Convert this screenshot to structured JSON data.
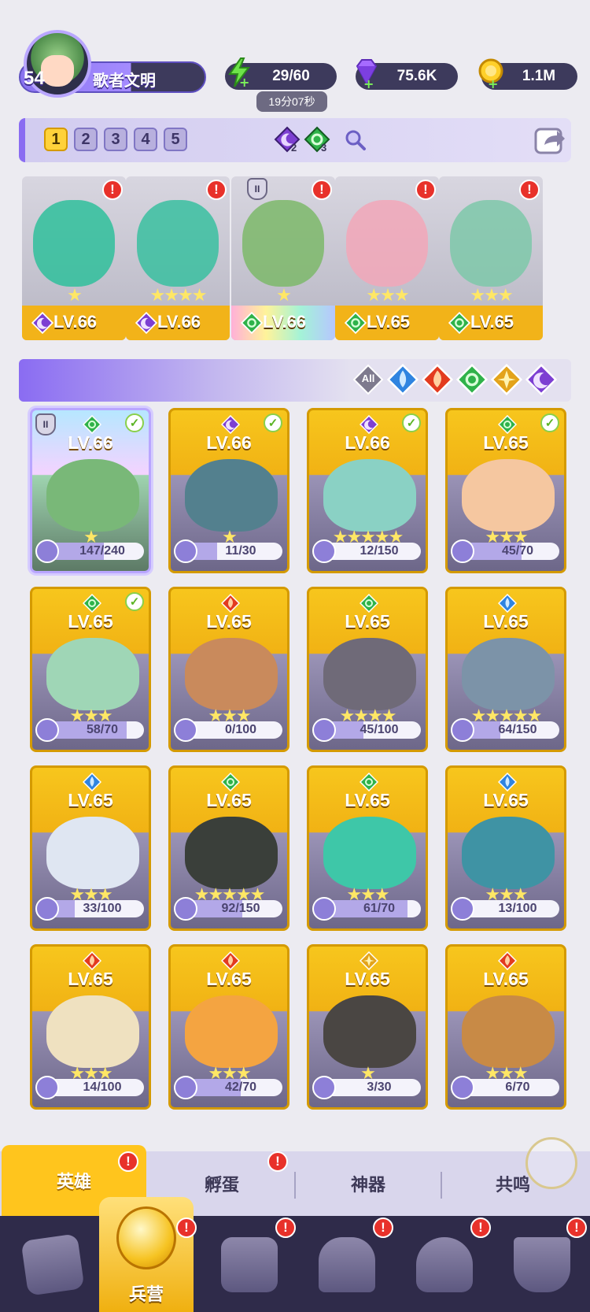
{
  "player": {
    "level": "54",
    "name": "歌者文明"
  },
  "resources": {
    "energy": "29/60",
    "energy_timer": "19分07秒",
    "gems": "75.6K",
    "coins": "1.1M"
  },
  "teams": {
    "tabs": [
      "1",
      "2",
      "3",
      "4",
      "5"
    ],
    "active": "1",
    "counters": [
      {
        "icon": "moon-element-icon",
        "count": "2"
      },
      {
        "icon": "leaf-element-icon",
        "count": "3"
      }
    ]
  },
  "team_slots": [
    {
      "level": "LV.66",
      "element": "moon",
      "stars": "★",
      "color": "#2fbf9b"
    },
    {
      "level": "LV.66",
      "element": "moon",
      "stars": "★★★★",
      "color": "#3ac0a0"
    },
    {
      "level": "LV.66",
      "element": "leaf",
      "stars": "★",
      "color": "#7cb86a",
      "rainbow": true
    },
    {
      "level": "LV.65",
      "element": "leaf",
      "stars": "★★★",
      "color": "#f2a7b8"
    },
    {
      "level": "LV.65",
      "element": "leaf",
      "stars": "★★★",
      "color": "#7ec8a9"
    }
  ],
  "filters": [
    "All",
    "water",
    "fire",
    "leaf",
    "light",
    "moon"
  ],
  "filter_all_label": "All",
  "colors": {
    "water": "#2f84e0",
    "fire": "#e33b1f",
    "leaf": "#2fb24a",
    "light": "#e3a31a",
    "moon": "#7d3fd2",
    "accent": "#8a6cf2"
  },
  "heroes": [
    {
      "level": "LV.66",
      "element": "leaf",
      "stars": "★",
      "progress": "147/240",
      "fraction": 0.61,
      "in_team": true,
      "selected": true,
      "art": "#79b878"
    },
    {
      "level": "LV.66",
      "element": "moon",
      "stars": "★",
      "progress": "11/30",
      "fraction": 0.37,
      "in_team": true,
      "art": "#53808e"
    },
    {
      "level": "LV.66",
      "element": "moon",
      "stars": "★★★★★",
      "progress": "12/150",
      "fraction": 0.08,
      "in_team": true,
      "art": "#8ad1c4"
    },
    {
      "level": "LV.65",
      "element": "leaf",
      "stars": "★★★",
      "progress": "45/70",
      "fraction": 0.64,
      "in_team": true,
      "art": "#f5c7a0"
    },
    {
      "level": "LV.65",
      "element": "leaf",
      "stars": "★★★",
      "progress": "58/70",
      "fraction": 0.83,
      "in_team": true,
      "art": "#9fd6b6"
    },
    {
      "level": "LV.65",
      "element": "fire",
      "stars": "★★★",
      "progress": "0/100",
      "fraction": 0,
      "art": "#c98a5c"
    },
    {
      "level": "LV.65",
      "element": "leaf",
      "stars": "★★★★",
      "progress": "45/100",
      "fraction": 0.45,
      "art": "#6f6a78"
    },
    {
      "level": "LV.65",
      "element": "water",
      "stars": "★★★★★",
      "progress": "64/150",
      "fraction": 0.43,
      "art": "#7c93a8"
    },
    {
      "level": "LV.65",
      "element": "water",
      "stars": "★★★",
      "progress": "33/100",
      "fraction": 0.33,
      "art": "#dfe6f2"
    },
    {
      "level": "LV.65",
      "element": "leaf",
      "stars": "★★★★★",
      "progress": "92/150",
      "fraction": 0.61,
      "art": "#3a3f3a"
    },
    {
      "level": "LV.65",
      "element": "leaf",
      "stars": "★★★",
      "progress": "61/70",
      "fraction": 0.87,
      "art": "#3ec7a8"
    },
    {
      "level": "LV.65",
      "element": "water",
      "stars": "★★★",
      "progress": "13/100",
      "fraction": 0.13,
      "art": "#3f93a4"
    },
    {
      "level": "LV.65",
      "element": "fire",
      "stars": "★★★",
      "progress": "14/100",
      "fraction": 0.14,
      "art": "#efe1c0"
    },
    {
      "level": "LV.65",
      "element": "fire",
      "stars": "★★★",
      "progress": "42/70",
      "fraction": 0.6,
      "art": "#f4a441"
    },
    {
      "level": "LV.65",
      "element": "light",
      "stars": "★",
      "progress": "3/30",
      "fraction": 0.1,
      "art": "#4a4643"
    },
    {
      "level": "LV.65",
      "element": "fire",
      "stars": "★★★",
      "progress": "6/70",
      "fraction": 0.09,
      "art": "#c88a46"
    }
  ],
  "subtabs": [
    "英雄",
    "孵蛋",
    "神器",
    "共鸣"
  ],
  "bottom_nav": {
    "active_label": "兵营",
    "items": [
      "cards-icon",
      "barracks-icon",
      "map-icon",
      "castle-icon",
      "mushroom-icon",
      "banner-icon"
    ]
  }
}
